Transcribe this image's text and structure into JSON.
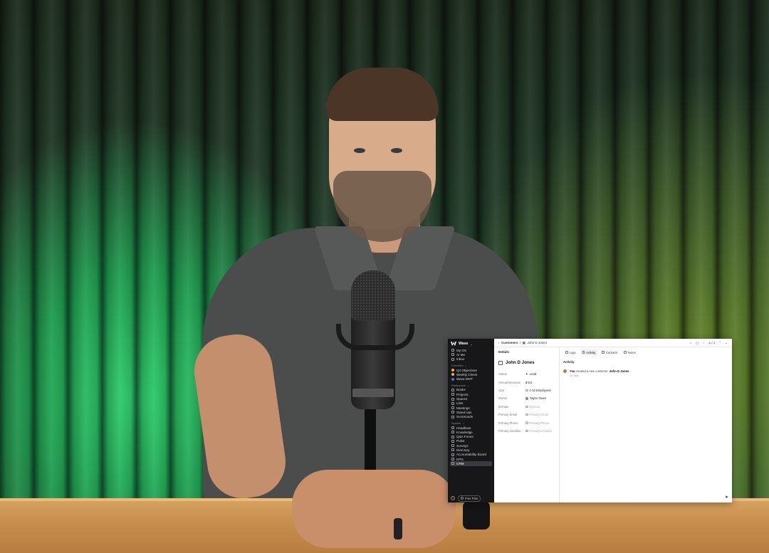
{
  "sidebar": {
    "workspace": "Wave",
    "top_items": [
      {
        "label": "My OS",
        "icon": "home-icon"
      },
      {
        "label": "AI Me",
        "icon": "sparkle-icon"
      },
      {
        "label": "Inbox",
        "icon": "inbox-icon"
      }
    ],
    "favorites_label": "Favorites",
    "favorites": [
      {
        "label": "Q4 Objectives",
        "color": "#f2b233"
      },
      {
        "label": "Weekly Check",
        "color": "#e6b94a"
      },
      {
        "label": "Wave MVP",
        "color": "#3a7be0"
      }
    ],
    "workspace_label": "Workspace",
    "workspace_items": [
      "Books",
      "Projects",
      "Spaces",
      "Lists",
      "Meetings",
      "Stand Ups",
      "Scorecards"
    ],
    "system_label": "System",
    "system_items": [
      "Headlines",
      "Knowledge",
      "Q&A Forum",
      "Pulse",
      "Surveys",
      "Directory",
      "Accountability Board",
      "KPIs",
      "CRM"
    ],
    "active_item": "CRM",
    "plan_label": "Free Plan",
    "help_icon": "?"
  },
  "topbar": {
    "breadcrumb_parent": "Customers",
    "breadcrumb_separator": "/",
    "breadcrumb_current": "John D Jones",
    "pager": "1 / 1"
  },
  "details": {
    "heading": "Details",
    "record_name": "John D Jones",
    "fields": [
      {
        "key": "Status",
        "value": "Lead",
        "placeholder": false
      },
      {
        "key": "Annual Revenue",
        "value": "$ 0.0",
        "placeholder": false
      },
      {
        "key": "Size",
        "value": "2-10 Employees",
        "placeholder": false
      },
      {
        "key": "Owner",
        "value": "Taylor Owen",
        "placeholder": false
      },
      {
        "key": "Domain",
        "value": "Domain",
        "placeholder": true
      },
      {
        "key": "Primary Email",
        "value": "Primary Email",
        "placeholder": true
      },
      {
        "key": "Primary Phone",
        "value": "Primary Phone",
        "placeholder": true
      },
      {
        "key": "Primary Location",
        "value": "Primary Location",
        "placeholder": true
      }
    ]
  },
  "activity": {
    "tabs": [
      "Logs",
      "Activity",
      "Contacts",
      "Notes"
    ],
    "selected_tab": "Activity",
    "heading": "Activity",
    "entry_actor": "You",
    "entry_text": " created a new customer: ",
    "entry_target": "John D Jones",
    "entry_time": "10 Sep"
  }
}
